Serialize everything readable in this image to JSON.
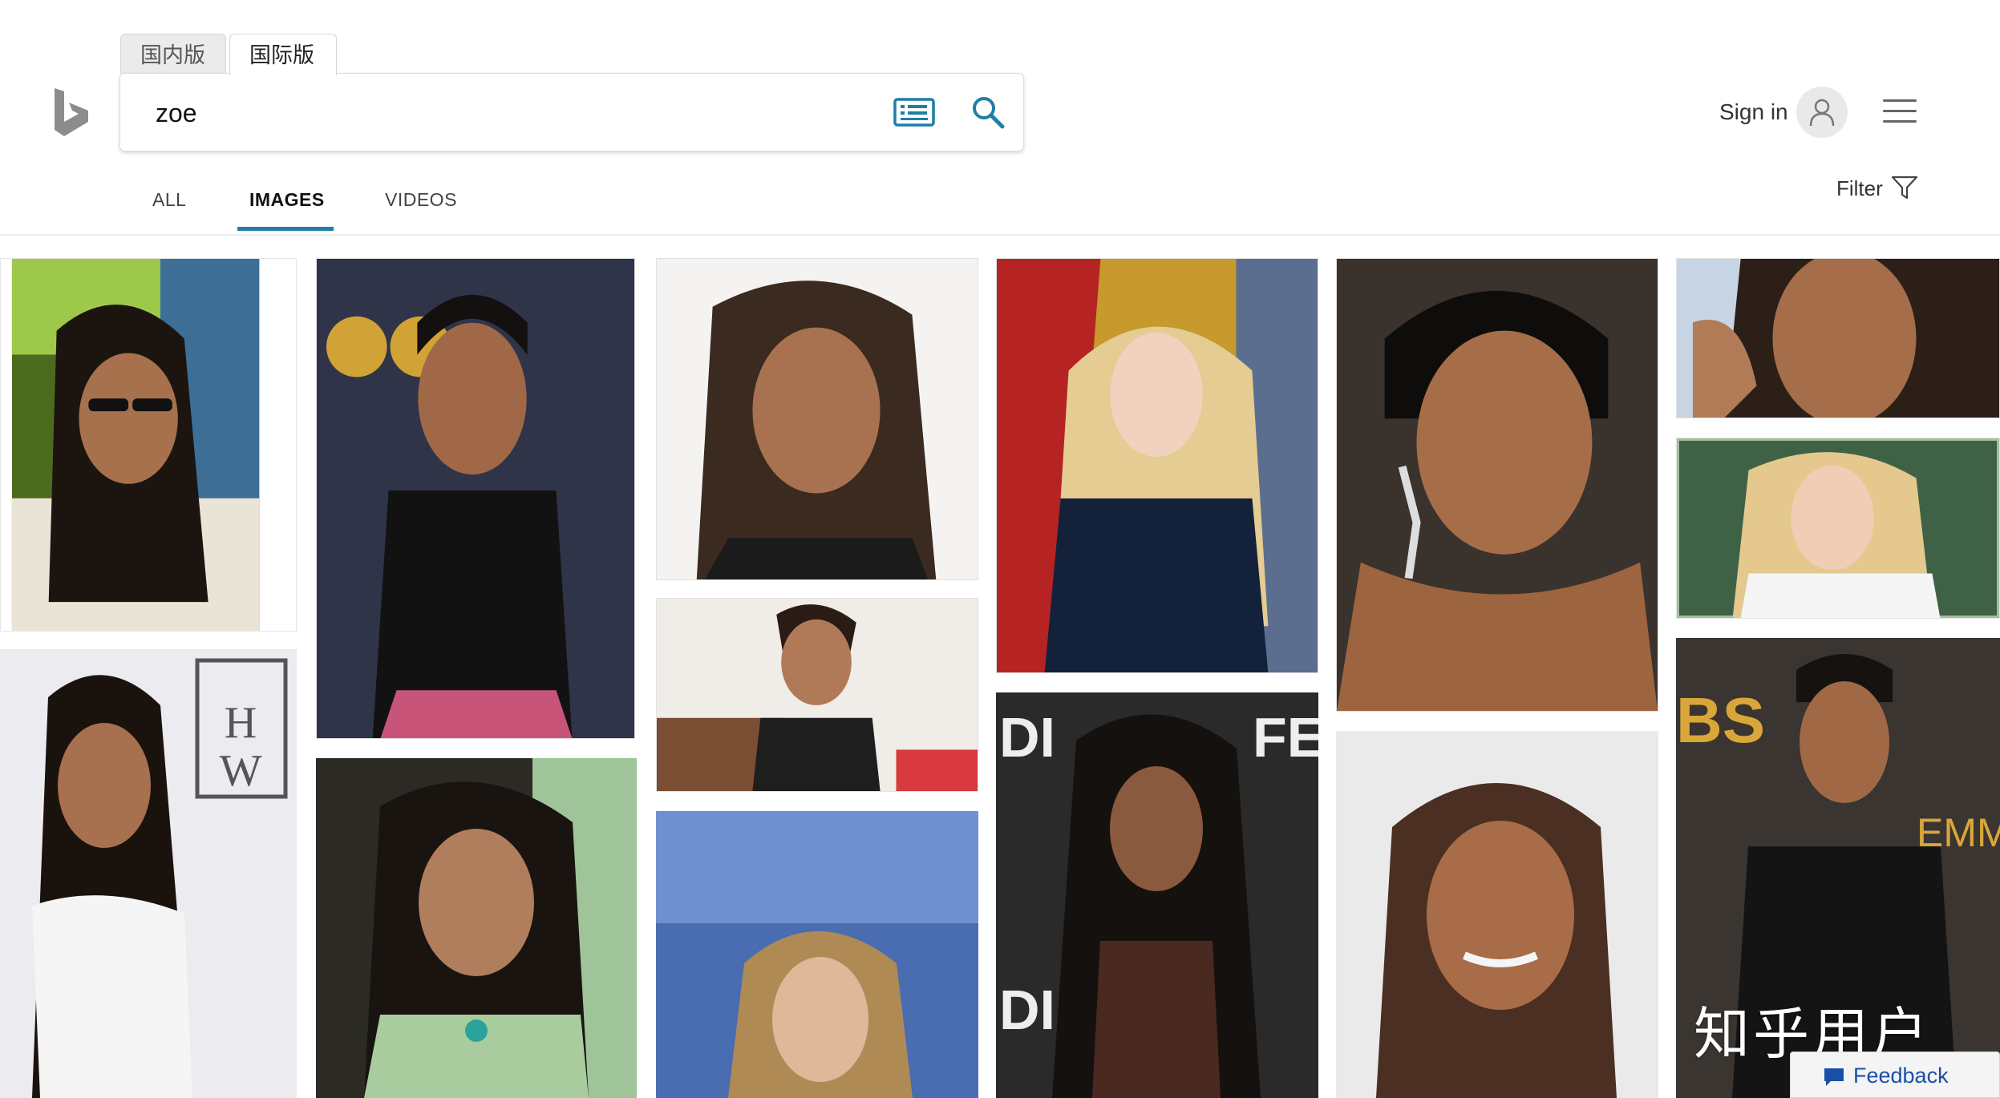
{
  "region_tabs": {
    "domestic": "国内版",
    "international": "国际版"
  },
  "search": {
    "query": "zoe"
  },
  "header": {
    "sign_in": "Sign in"
  },
  "nav_tabs": [
    "ALL",
    "IMAGES",
    "VIDEOS"
  ],
  "active_tab": "IMAGES",
  "filter_label": "Filter",
  "watermark": "知乎用户",
  "feedback_label": "Feedback",
  "colors": {
    "accent": "#1f7fa6",
    "bing_logo": "#8c8c8c",
    "feedback_text": "#1a4fa8"
  },
  "icons": [
    "bing-logo-icon",
    "keyboard-icon",
    "search-icon",
    "user-icon",
    "hamburger-menu-icon",
    "filter-funnel-icon",
    "feedback-chat-icon"
  ],
  "image_results": [
    "woman with braids and sunglasses on green backdrop",
    "woman in black feathered dress in front of CBS logo",
    "woman with shoulder-length brown hair on white background",
    "blonde woman in navy blazer arms crossed",
    "woman with slicked-back hair and chandelier earrings",
    "close-up of woman touching her hair",
    "woman with braids in white dress at event",
    "smiling woman with short hair in studio",
    "blonde woman with wavy hair near lattice",
    "young woman with bangs and turquoise necklace",
    "woman with long braids at Fendi event",
    "smiling woman with brown hair on grey background",
    "woman with blonde hair in front of blue backdrop",
    "woman in black feathered dress at Emmys"
  ]
}
